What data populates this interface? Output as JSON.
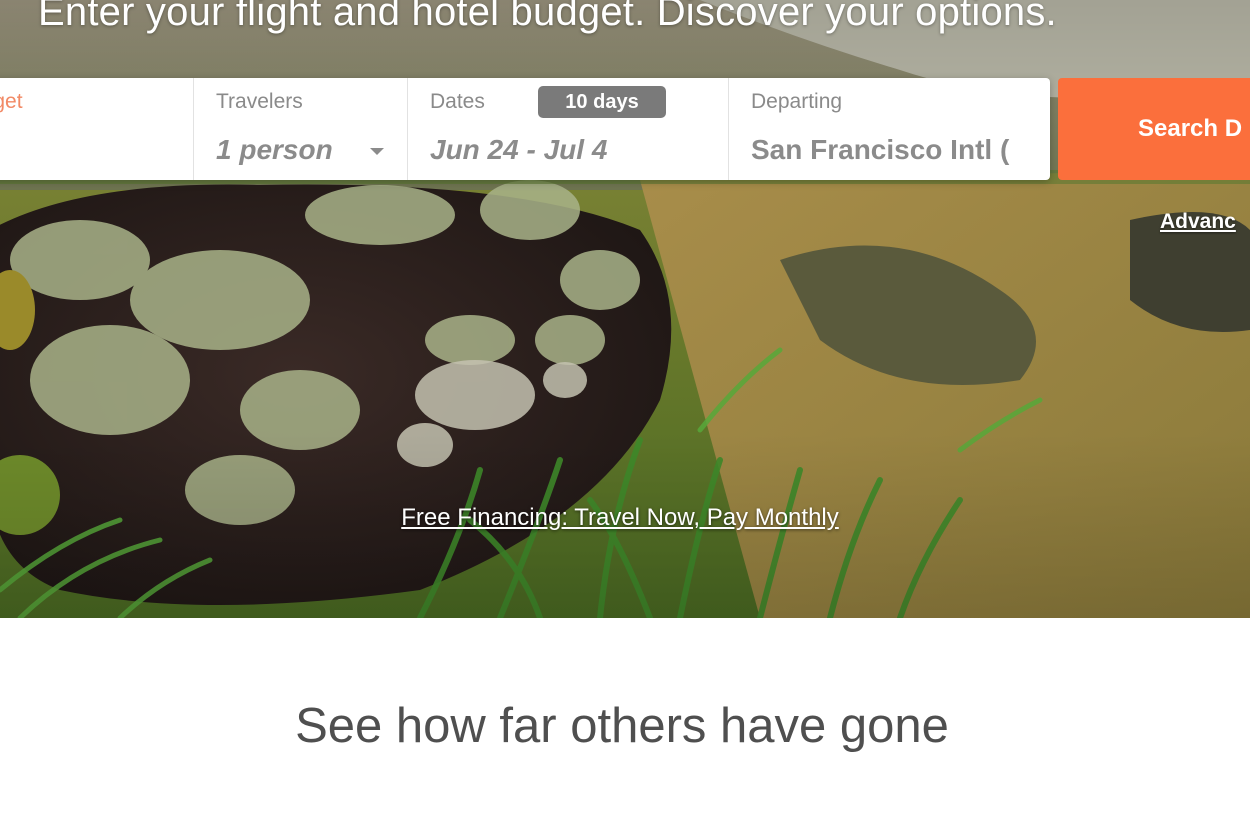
{
  "hero": {
    "headline": "Enter your flight and hotel budget. Discover your options.",
    "financing_link": "Free Financing: Travel Now, Pay Monthly"
  },
  "search": {
    "budget_label": "udget",
    "travelers_label": "Travelers",
    "travelers_value": "1 person",
    "dates_label": "Dates",
    "days_badge": "10 days",
    "dates_value": "Jun 24 - Jul 4",
    "departing_label": "Departing",
    "departing_value": "San Francisco Intl (",
    "search_button": "Search D",
    "advanced_link": "Advanc"
  },
  "section": {
    "title": "See how far others have gone"
  },
  "colors": {
    "accent": "#fb6f3c",
    "budget_label": "#f28a66",
    "badge": "#7a7a7a",
    "heading": "#4f4f4f"
  }
}
